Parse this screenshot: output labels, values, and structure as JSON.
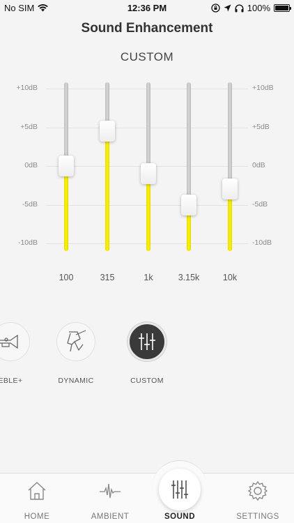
{
  "status_bar": {
    "carrier": "No SIM",
    "time": "12:36 PM",
    "battery": "100%"
  },
  "header": {
    "title": "Sound Enhancement",
    "preset": "CUSTOM"
  },
  "equalizer": {
    "db_scale": [
      "+10dB",
      "+5dB",
      "0dB",
      "-5dB",
      "-10dB"
    ],
    "bands": [
      {
        "freq": "100",
        "gain_db": 0
      },
      {
        "freq": "315",
        "gain_db": 4.5
      },
      {
        "freq": "1k",
        "gain_db": -1
      },
      {
        "freq": "3.15k",
        "gain_db": -5
      },
      {
        "freq": "10k",
        "gain_db": -3
      }
    ],
    "colors": {
      "fill": "#fff200",
      "track": "#c8c8c8"
    }
  },
  "presets": {
    "items": [
      {
        "label": "EBLE+",
        "icon": "trumpet-icon"
      },
      {
        "label": "DYNAMIC",
        "icon": "drummer-icon"
      },
      {
        "label": "CUSTOM",
        "icon": "sliders-icon",
        "active": true
      }
    ]
  },
  "tabbar": {
    "tabs": [
      {
        "label": "HOME",
        "icon": "home-icon"
      },
      {
        "label": "AMBIENT",
        "icon": "waveform-icon"
      },
      {
        "label": "SOUND",
        "icon": "equalizer-icon",
        "active": true
      },
      {
        "label": "SETTINGS",
        "icon": "gear-icon"
      }
    ]
  }
}
